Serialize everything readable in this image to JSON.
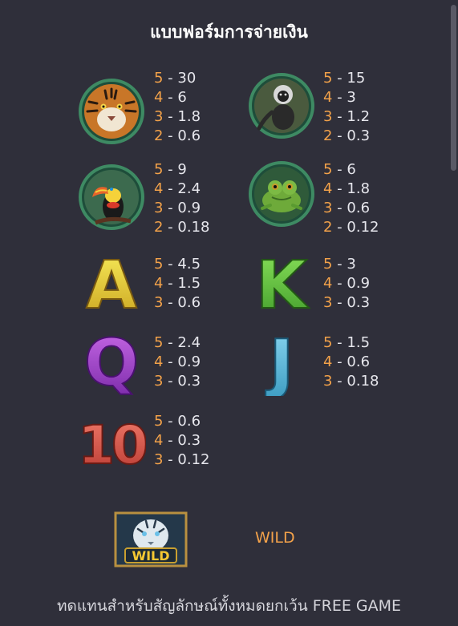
{
  "title": "แบบฟอร์มการจ่ายเงิน",
  "symbols": [
    {
      "name": "tiger",
      "payouts": [
        {
          "count": "5",
          "value": "30"
        },
        {
          "count": "4",
          "value": "6"
        },
        {
          "count": "3",
          "value": "1.8"
        },
        {
          "count": "2",
          "value": "0.6"
        }
      ]
    },
    {
      "name": "monkey",
      "payouts": [
        {
          "count": "5",
          "value": "15"
        },
        {
          "count": "4",
          "value": "3"
        },
        {
          "count": "3",
          "value": "1.2"
        },
        {
          "count": "2",
          "value": "0.3"
        }
      ]
    },
    {
      "name": "toucan",
      "payouts": [
        {
          "count": "5",
          "value": "9"
        },
        {
          "count": "4",
          "value": "2.4"
        },
        {
          "count": "3",
          "value": "0.9"
        },
        {
          "count": "2",
          "value": "0.18"
        }
      ]
    },
    {
      "name": "frog",
      "payouts": [
        {
          "count": "5",
          "value": "6"
        },
        {
          "count": "4",
          "value": "1.8"
        },
        {
          "count": "3",
          "value": "0.6"
        },
        {
          "count": "2",
          "value": "0.12"
        }
      ]
    },
    {
      "name": "letter-a",
      "payouts": [
        {
          "count": "5",
          "value": "4.5"
        },
        {
          "count": "4",
          "value": "1.5"
        },
        {
          "count": "3",
          "value": "0.6"
        }
      ]
    },
    {
      "name": "letter-k",
      "payouts": [
        {
          "count": "5",
          "value": "3"
        },
        {
          "count": "4",
          "value": "0.9"
        },
        {
          "count": "3",
          "value": "0.3"
        }
      ]
    },
    {
      "name": "letter-q",
      "payouts": [
        {
          "count": "5",
          "value": "2.4"
        },
        {
          "count": "4",
          "value": "0.9"
        },
        {
          "count": "3",
          "value": "0.3"
        }
      ]
    },
    {
      "name": "letter-j",
      "payouts": [
        {
          "count": "5",
          "value": "1.5"
        },
        {
          "count": "4",
          "value": "0.6"
        },
        {
          "count": "3",
          "value": "0.18"
        }
      ]
    },
    {
      "name": "number-10",
      "payouts": [
        {
          "count": "5",
          "value": "0.6"
        },
        {
          "count": "4",
          "value": "0.3"
        },
        {
          "count": "3",
          "value": "0.12"
        }
      ]
    }
  ],
  "glyphs": {
    "a": "A",
    "k": "K",
    "q": "Q",
    "j": "J",
    "ten": "10"
  },
  "wild": {
    "badge": "WILD",
    "label": "WILD"
  },
  "footer": "ทดแทนสำหรับสัญลักษณ์ทั้งหมดยกเว้น FREE GAME",
  "colors": {
    "accent": "#f3a24a",
    "background": "#2f2f3a"
  }
}
